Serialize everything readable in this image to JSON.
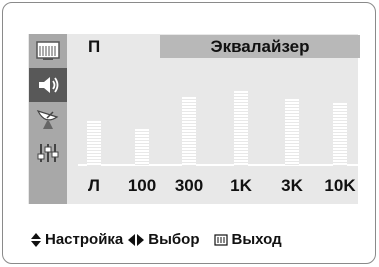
{
  "menu": {
    "mode_label": "П",
    "title": "Эквалайзер",
    "sidebar": [
      {
        "icon": "tv-picture-icon",
        "active": false
      },
      {
        "icon": "speaker-sound-icon",
        "active": true
      },
      {
        "icon": "satellite-channel-icon",
        "active": false
      },
      {
        "icon": "sliders-setup-icon",
        "active": false
      },
      {
        "icon": "blank",
        "active": false
      }
    ]
  },
  "chart_data": {
    "type": "bar",
    "title": "Эквалайзер",
    "categories": [
      "Л",
      "100",
      "300",
      "1K",
      "3K",
      "10K"
    ],
    "values": [
      0.45,
      0.37,
      0.69,
      0.75,
      0.67,
      0.63
    ],
    "ylim": [
      0,
      1
    ]
  },
  "footer": {
    "adjust_label": "Настройка",
    "select_label": "Выбор",
    "exit_label": "Выход"
  }
}
